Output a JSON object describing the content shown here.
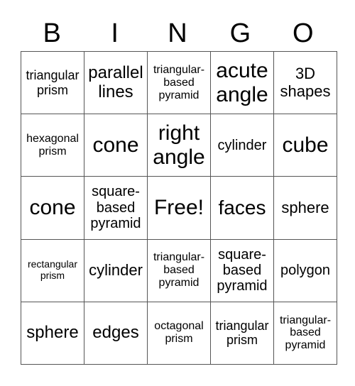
{
  "header": [
    "B",
    "I",
    "N",
    "G",
    "O"
  ],
  "rows": [
    [
      "triangular prism",
      "parallel lines",
      "triangular-based pyramid",
      "acute angle",
      "3D shapes"
    ],
    [
      "hexagonal prism",
      "cone",
      "right angle",
      "cylinder",
      "cube"
    ],
    [
      "cone",
      "square-based pyramid",
      "Free!",
      "faces",
      "sphere"
    ],
    [
      "rectangular prism",
      "cylinder",
      "triangular-based pyramid",
      "square-based pyramid",
      "polygon"
    ],
    [
      "sphere",
      "edges",
      "octagonal prism",
      "triangular prism",
      "triangular-based pyramid"
    ]
  ]
}
